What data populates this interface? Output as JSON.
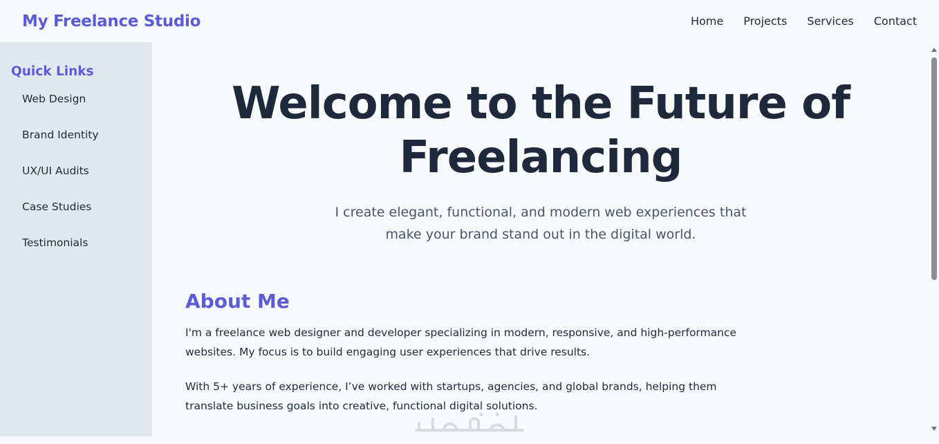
{
  "header": {
    "brand": "My Freelance Studio",
    "nav": [
      "Home",
      "Projects",
      "Services",
      "Contact"
    ]
  },
  "sidebar": {
    "title": "Quick Links",
    "items": [
      "Web Design",
      "Brand Identity",
      "UX/UI Audits",
      "Case Studies",
      "Testimonials"
    ]
  },
  "hero": {
    "title": "Welcome to the Future of Freelancing",
    "subtitle": "I create elegant, functional, and modern web experiences that make your brand stand out in the digital world."
  },
  "about": {
    "heading": "About Me",
    "paragraphs": [
      "I'm a freelance web designer and developer specializing in modern, responsive, and high-performance websites. My focus is to build engaging user experiences that drive results.",
      "With 5+ years of experience, I’ve worked with startups, agencies, and global brands, helping them translate business goals into creative, functional digital solutions."
    ]
  },
  "watermark": {
    "text": "خمسات"
  },
  "colors": {
    "accent": "#5b5bd6",
    "sidebar_bg": "#e2e8f0",
    "page_bg": "#f8fafc",
    "text": "#1e293b",
    "muted_text": "#475569"
  }
}
